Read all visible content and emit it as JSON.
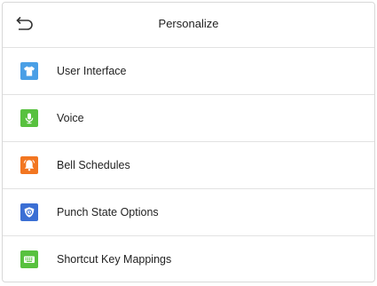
{
  "header": {
    "title": "Personalize",
    "back_icon": "back-arrow-icon"
  },
  "menu": {
    "items": [
      {
        "label": "User Interface",
        "icon": "tshirt-icon",
        "color": "#4a9fe6"
      },
      {
        "label": "Voice",
        "icon": "microphone-icon",
        "color": "#58c13f"
      },
      {
        "label": "Bell Schedules",
        "icon": "bell-icon",
        "color": "#f27621"
      },
      {
        "label": "Punch State Options",
        "icon": "shield-icon",
        "color": "#3b6fd4"
      },
      {
        "label": "Shortcut Key Mappings",
        "icon": "keyboard-icon",
        "color": "#58c13f"
      }
    ]
  }
}
